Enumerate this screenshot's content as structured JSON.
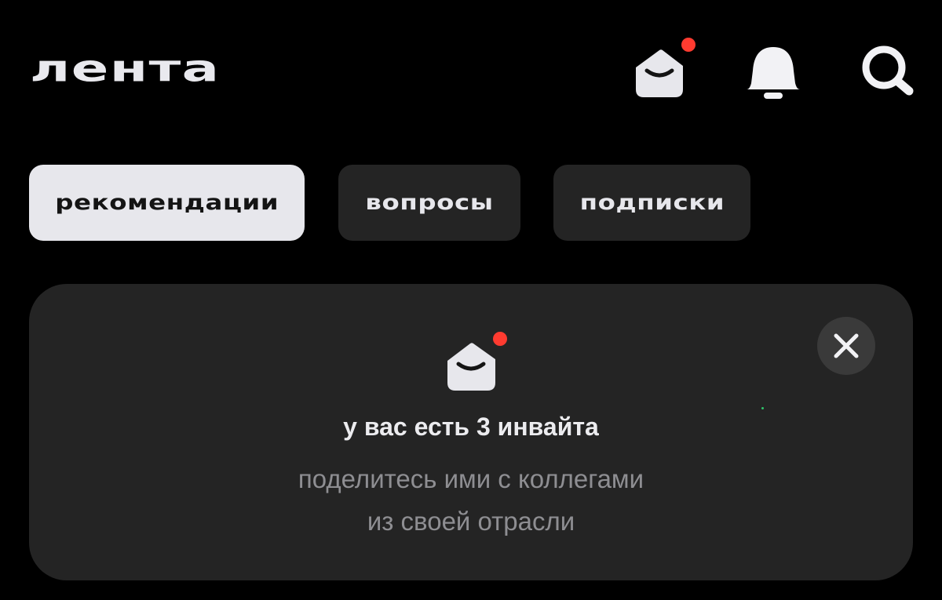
{
  "header": {
    "title": "лента",
    "icons": {
      "invites": "envelope-with-notification-icon",
      "notifications": "bell-icon",
      "search": "search-icon"
    }
  },
  "tabs": [
    {
      "label": "рекомендации",
      "active": true
    },
    {
      "label": "вопросы",
      "active": false
    },
    {
      "label": "подписки",
      "active": false
    }
  ],
  "invite_card": {
    "title": "у вас есть 3 инвайта",
    "text_line1": "поделитесь ими с коллегами",
    "text_line2": "из своей отрасли",
    "icon": "envelope-with-notification-icon",
    "close_icon": "close-icon"
  },
  "colors": {
    "background": "#000000",
    "card": "#242424",
    "active_tab": "#e7e7ec",
    "notification_dot": "#ff3b30",
    "text_primary": "#ececef",
    "text_secondary": "#8e8e92"
  }
}
